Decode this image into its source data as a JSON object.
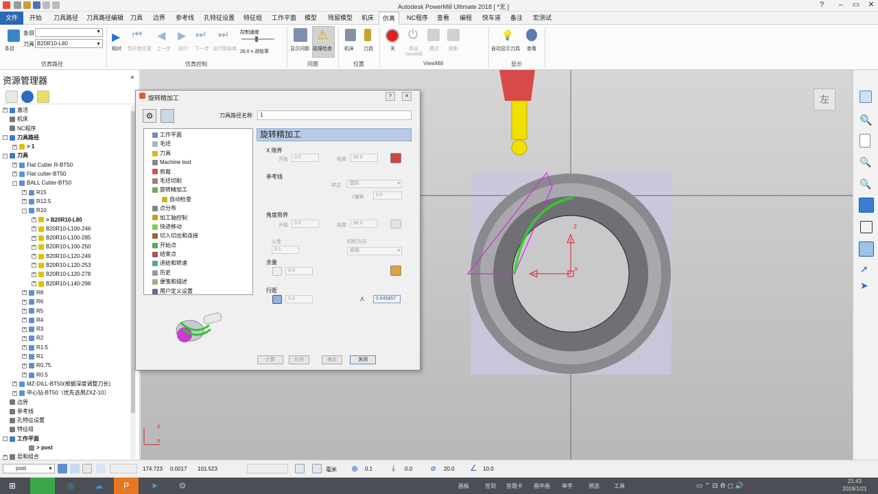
{
  "titlebar": {
    "title": "Autodesk PowerMill Ultimate 2018  [ *无 ]"
  },
  "menu": {
    "tabs": [
      "文件",
      "开始",
      "刀具路径",
      "刀具路径编辑",
      "刀具",
      "边界",
      "参考线",
      "孔特征设置",
      "特征组",
      "工作平面",
      "模型",
      "残留模型",
      "机床",
      "仿真",
      "NC程序",
      "查看",
      "编程",
      "快车道",
      "备注",
      "宏测试"
    ],
    "active": "仿真"
  },
  "ribbon": {
    "item_label": "条目",
    "tool_label": "刀具",
    "tool_value": "B20R10-L80",
    "control_speed": "控制速度",
    "speed_value": "26.0 x 进给率",
    "buttons": {
      "item": "条目",
      "relative": "相对",
      "rewind": "到开始位置",
      "stepback": "上一步",
      "run": "运行",
      "stepfwd": "下一步",
      "end": "运行到结束",
      "show_issues": "显示问题",
      "collision": "碰撞检查",
      "machine": "机床",
      "tool": "刀具",
      "off": "关",
      "exit": "退出 ViewMill",
      "mode": "模式",
      "shade": "阴影",
      "auto_show_tool": "自动显示刀具",
      "view": "查看"
    },
    "groups": {
      "sim_path": "仿真路径",
      "sim_control": "仿真控制",
      "issues": "问题",
      "position": "位置",
      "viewmill": "ViewMill",
      "display": "显示"
    }
  },
  "explorer": {
    "title": "资源管理器",
    "rows": [
      {
        "t": "激活",
        "ex": "+",
        "lvl": 0,
        "ic": "#3a7bd5"
      },
      {
        "t": "机床",
        "ex": "",
        "lvl": 0,
        "ic": "#777"
      },
      {
        "t": "NC程序",
        "ex": "",
        "lvl": 0,
        "ic": "#777"
      },
      {
        "t": "刀具路径",
        "ex": "-",
        "lvl": 0,
        "ic": "#3a7bd5",
        "b": true
      },
      {
        "t": "> 1",
        "ex": "+",
        "lvl": 1,
        "ic": "#e0c000",
        "b": true
      },
      {
        "t": "刀具",
        "ex": "-",
        "lvl": 0,
        "ic": "#3a7bd5",
        "b": true
      },
      {
        "t": "Flat Cutter R-BT50",
        "ex": "+",
        "lvl": 1,
        "ic": "#5b8fd8"
      },
      {
        "t": "Flat cutter-BT50",
        "ex": "+",
        "lvl": 1,
        "ic": "#5b8fd8"
      },
      {
        "t": "BALL Cutter-BT50",
        "ex": "-",
        "lvl": 1,
        "ic": "#5b8fd8"
      },
      {
        "t": "R15",
        "ex": "+",
        "lvl": 2,
        "ic": "#5b8fd8"
      },
      {
        "t": "R12.5",
        "ex": "+",
        "lvl": 2,
        "ic": "#5b8fd8"
      },
      {
        "t": "R10",
        "ex": "-",
        "lvl": 2,
        "ic": "#5b8fd8"
      },
      {
        "t": "> B20R10-L80",
        "ex": "+",
        "lvl": 3,
        "ic": "#e0c000",
        "b": true
      },
      {
        "t": "B20R10-L100-246",
        "ex": "+",
        "lvl": 3,
        "ic": "#e0c000"
      },
      {
        "t": "B20R10-L100-285",
        "ex": "+",
        "lvl": 3,
        "ic": "#e0c000"
      },
      {
        "t": "B20R10-L100-250",
        "ex": "+",
        "lvl": 3,
        "ic": "#e0c000"
      },
      {
        "t": "B20R10-L120-249",
        "ex": "+",
        "lvl": 3,
        "ic": "#e0c000"
      },
      {
        "t": "B20R10-L120-253",
        "ex": "+",
        "lvl": 3,
        "ic": "#e0c000"
      },
      {
        "t": "B20R10-L120-278",
        "ex": "+",
        "lvl": 3,
        "ic": "#e0c000"
      },
      {
        "t": "B20R10-L140-298",
        "ex": "+",
        "lvl": 3,
        "ic": "#e0c000"
      },
      {
        "t": "R8",
        "ex": "+",
        "lvl": 2,
        "ic": "#5b8fd8"
      },
      {
        "t": "R6",
        "ex": "+",
        "lvl": 2,
        "ic": "#5b8fd8"
      },
      {
        "t": "R5",
        "ex": "+",
        "lvl": 2,
        "ic": "#5b8fd8"
      },
      {
        "t": "R4",
        "ex": "+",
        "lvl": 2,
        "ic": "#5b8fd8"
      },
      {
        "t": "R3",
        "ex": "+",
        "lvl": 2,
        "ic": "#5b8fd8"
      },
      {
        "t": "R2",
        "ex": "+",
        "lvl": 2,
        "ic": "#5b8fd8"
      },
      {
        "t": "R1.5",
        "ex": "+",
        "lvl": 2,
        "ic": "#5b8fd8"
      },
      {
        "t": "R1",
        "ex": "+",
        "lvl": 2,
        "ic": "#5b8fd8"
      },
      {
        "t": "R0.75",
        "ex": "+",
        "lvl": 2,
        "ic": "#5b8fd8"
      },
      {
        "t": "R0.5",
        "ex": "+",
        "lvl": 2,
        "ic": "#5b8fd8"
      },
      {
        "t": "MZ-DILL-BT50(根据深度调整刀长)",
        "ex": "+",
        "lvl": 1,
        "ic": "#5b8fd8"
      },
      {
        "t": "中心钻-BT50（优先选用ZXZ-10）",
        "ex": "+",
        "lvl": 1,
        "ic": "#5b8fd8"
      },
      {
        "t": "边界",
        "ex": "",
        "lvl": 0,
        "ic": "#777"
      },
      {
        "t": "参考线",
        "ex": "",
        "lvl": 0,
        "ic": "#777"
      },
      {
        "t": "孔特征设置",
        "ex": "",
        "lvl": 0,
        "ic": "#777"
      },
      {
        "t": "特征组",
        "ex": "",
        "lvl": 0,
        "ic": "#777"
      },
      {
        "t": "工作平面",
        "ex": "-",
        "lvl": 0,
        "ic": "#3a7bd5",
        "b": true
      },
      {
        "t": "> post",
        "ex": "",
        "lvl": 2,
        "ic": "#888",
        "b": true
      },
      {
        "t": "层和组合",
        "ex": "+",
        "lvl": 0,
        "ic": "#777"
      }
    ]
  },
  "dialog": {
    "title": "旋转精加工",
    "help": "?",
    "close": "✕",
    "path_name_label": "刀具路径名称",
    "path_name_value": "1",
    "tree": [
      "工作平面",
      "毛坯",
      "刀具",
      "Machine tool",
      "剪裁",
      "毛坯切削",
      "旋转精加工",
      "自动检查",
      "点分布",
      "加工轴控制",
      "快进移动",
      "切入切出和连接",
      "开始点",
      "结束点",
      "进给和转速",
      "历史",
      "便笺和描述",
      "用户定义设置"
    ],
    "section_title": "旋转精加工",
    "x_limit": "X 限界",
    "start": "开始",
    "start_val": "0.0",
    "end": "结束",
    "end_val": "50.0",
    "ref_line": "参考线",
    "style": "样式",
    "style_val": "圆形",
    "y_offset": "Y偏移",
    "y_offset_val": "0.0",
    "angle_limit": "角度限界",
    "a_start_val": "0.0",
    "a_end_val": "90.0",
    "tolerance": "公差",
    "tol_val": "0.1",
    "cut_dir": "切削方向",
    "cut_dir_val": "顺铣",
    "allowance": "余量",
    "allow_val": "0.0",
    "stepover": "行距",
    "step_val": "5.0",
    "scallop_val": "0.645857",
    "btns": [
      "计算",
      "队列",
      "确定",
      "关闭"
    ]
  },
  "viewport": {
    "view_label": "左",
    "axis_z": "Z",
    "axis_x": "X"
  },
  "status": {
    "workplane": "post",
    "x": "174.723",
    "y": "0.0017",
    "z": "101.523",
    "unit": "毫米",
    "tol": "0.1",
    "thick": "0.0",
    "angle": "20.0",
    "step": "10.0"
  },
  "taskbar": {
    "items": [
      "画板",
      "签到",
      "答题卡",
      "画中画",
      "举手",
      "预选",
      "工具"
    ],
    "time": "21:43",
    "date": "2019/1/21"
  }
}
